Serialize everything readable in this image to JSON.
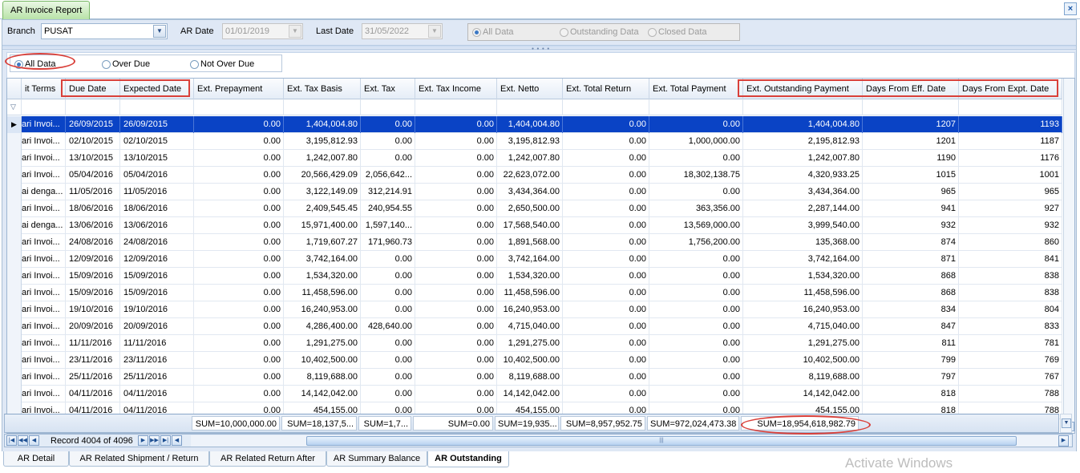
{
  "window": {
    "tab_title": "AR Invoice Report",
    "close_glyph": "×"
  },
  "filters": {
    "branch_label": "Branch",
    "branch_value": "PUSAT",
    "ar_date_label": "AR Date",
    "ar_date_value": "01/01/2019",
    "last_date_label": "Last Date",
    "last_date_value": "31/05/2022",
    "status_options": [
      "All Data",
      "Outstanding Data",
      "Closed Data"
    ]
  },
  "due_filter": {
    "options": [
      "All Data",
      "Over Due",
      "Not Over Due"
    ],
    "selected": "All Data"
  },
  "grid": {
    "columns": [
      "it Terms",
      "Due Date",
      "Expected Date",
      "Ext. Prepayment",
      "Ext. Tax Basis",
      "Ext. Tax",
      "Ext. Tax Income",
      "Ext. Netto",
      "Ext. Total Return",
      "Ext. Total Payment",
      "Ext. Outstanding Payment",
      "Days From Eff. Date",
      "Days From Expt. Date"
    ],
    "rows": [
      [
        "ari Invoi...",
        "26/09/2015",
        "26/09/2015",
        "0.00",
        "1,404,004.80",
        "0.00",
        "0.00",
        "1,404,004.80",
        "0.00",
        "0.00",
        "1,404,004.80",
        "1207",
        "1193"
      ],
      [
        "ari Invoi...",
        "02/10/2015",
        "02/10/2015",
        "0.00",
        "3,195,812.93",
        "0.00",
        "0.00",
        "3,195,812.93",
        "0.00",
        "1,000,000.00",
        "2,195,812.93",
        "1201",
        "1187"
      ],
      [
        "ari Invoi...",
        "13/10/2015",
        "13/10/2015",
        "0.00",
        "1,242,007.80",
        "0.00",
        "0.00",
        "1,242,007.80",
        "0.00",
        "0.00",
        "1,242,007.80",
        "1190",
        "1176"
      ],
      [
        "ari Invoi...",
        "05/04/2016",
        "05/04/2016",
        "0.00",
        "20,566,429.09",
        "2,056,642...",
        "0.00",
        "22,623,072.00",
        "0.00",
        "18,302,138.75",
        "4,320,933.25",
        "1015",
        "1001"
      ],
      [
        "ai denga...",
        "11/05/2016",
        "11/05/2016",
        "0.00",
        "3,122,149.09",
        "312,214.91",
        "0.00",
        "3,434,364.00",
        "0.00",
        "0.00",
        "3,434,364.00",
        "965",
        "965"
      ],
      [
        "ari Invoi...",
        "18/06/2016",
        "18/06/2016",
        "0.00",
        "2,409,545.45",
        "240,954.55",
        "0.00",
        "2,650,500.00",
        "0.00",
        "363,356.00",
        "2,287,144.00",
        "941",
        "927"
      ],
      [
        "ai denga...",
        "13/06/2016",
        "13/06/2016",
        "0.00",
        "15,971,400.00",
        "1,597,140...",
        "0.00",
        "17,568,540.00",
        "0.00",
        "13,569,000.00",
        "3,999,540.00",
        "932",
        "932"
      ],
      [
        "ari Invoi...",
        "24/08/2016",
        "24/08/2016",
        "0.00",
        "1,719,607.27",
        "171,960.73",
        "0.00",
        "1,891,568.00",
        "0.00",
        "1,756,200.00",
        "135,368.00",
        "874",
        "860"
      ],
      [
        "ari Invoi...",
        "12/09/2016",
        "12/09/2016",
        "0.00",
        "3,742,164.00",
        "0.00",
        "0.00",
        "3,742,164.00",
        "0.00",
        "0.00",
        "3,742,164.00",
        "871",
        "841"
      ],
      [
        "ari Invoi...",
        "15/09/2016",
        "15/09/2016",
        "0.00",
        "1,534,320.00",
        "0.00",
        "0.00",
        "1,534,320.00",
        "0.00",
        "0.00",
        "1,534,320.00",
        "868",
        "838"
      ],
      [
        "ari Invoi...",
        "15/09/2016",
        "15/09/2016",
        "0.00",
        "11,458,596.00",
        "0.00",
        "0.00",
        "11,458,596.00",
        "0.00",
        "0.00",
        "11,458,596.00",
        "868",
        "838"
      ],
      [
        "ari Invoi...",
        "19/10/2016",
        "19/10/2016",
        "0.00",
        "16,240,953.00",
        "0.00",
        "0.00",
        "16,240,953.00",
        "0.00",
        "0.00",
        "16,240,953.00",
        "834",
        "804"
      ],
      [
        "ari Invoi...",
        "20/09/2016",
        "20/09/2016",
        "0.00",
        "4,286,400.00",
        "428,640.00",
        "0.00",
        "4,715,040.00",
        "0.00",
        "0.00",
        "4,715,040.00",
        "847",
        "833"
      ],
      [
        "ari Invoi...",
        "11/11/2016",
        "11/11/2016",
        "0.00",
        "1,291,275.00",
        "0.00",
        "0.00",
        "1,291,275.00",
        "0.00",
        "0.00",
        "1,291,275.00",
        "811",
        "781"
      ],
      [
        "ari Invoi...",
        "23/11/2016",
        "23/11/2016",
        "0.00",
        "10,402,500.00",
        "0.00",
        "0.00",
        "10,402,500.00",
        "0.00",
        "0.00",
        "10,402,500.00",
        "799",
        "769"
      ],
      [
        "ari Invoi...",
        "25/11/2016",
        "25/11/2016",
        "0.00",
        "8,119,688.00",
        "0.00",
        "0.00",
        "8,119,688.00",
        "0.00",
        "0.00",
        "8,119,688.00",
        "797",
        "767"
      ],
      [
        "ari Invoi...",
        "04/11/2016",
        "04/11/2016",
        "0.00",
        "14,142,042.00",
        "0.00",
        "0.00",
        "14,142,042.00",
        "0.00",
        "0.00",
        "14,142,042.00",
        "818",
        "788"
      ],
      [
        "ari Invoi...",
        "04/11/2016",
        "04/11/2016",
        "0.00",
        "454,155.00",
        "0.00",
        "0.00",
        "454,155.00",
        "0.00",
        "0.00",
        "454,155.00",
        "818",
        "788"
      ]
    ],
    "selected_row": 0,
    "sums": [
      "SUM=10,000,000.00",
      "SUM=18,137,5...",
      "SUM=1,7...",
      "SUM=0.00",
      "SUM=19,935...",
      "SUM=8,957,952.75",
      "SUM=972,024,473.38",
      "SUM=18,954,618,982.79"
    ]
  },
  "navigator": {
    "record_text": "Record 4004 of 4096"
  },
  "bottom_tabs": {
    "items": [
      "AR Detail",
      "AR Related Shipment / Return",
      "AR Related Return After",
      "AR Summary Balance",
      "AR Outstanding"
    ],
    "active": "AR Outstanding"
  },
  "watermark": "Activate Windows",
  "colors": {
    "selected_row": "#0a43c5",
    "annotation": "#d9403a",
    "tab_green": "#b9e3a8"
  }
}
